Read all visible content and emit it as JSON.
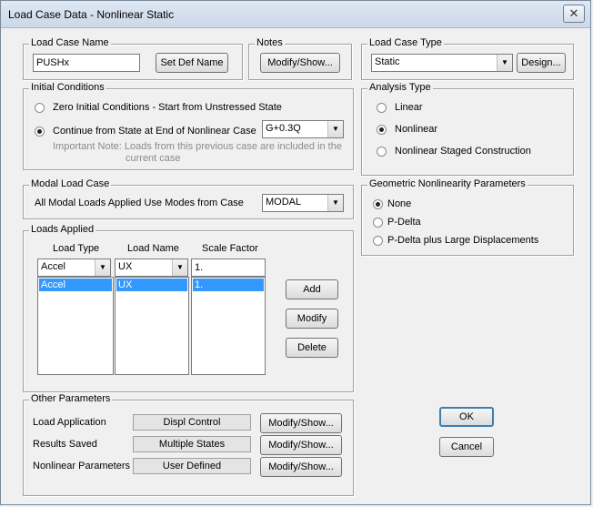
{
  "window": {
    "title": "Load Case Data - Nonlinear Static",
    "close_glyph": "✕"
  },
  "load_case_name": {
    "legend": "Load Case Name",
    "value": "PUSHx",
    "set_def_button": "Set Def Name"
  },
  "notes": {
    "legend": "Notes",
    "button": "Modify/Show..."
  },
  "load_case_type": {
    "legend": "Load Case Type",
    "value": "Static",
    "design_button": "Design..."
  },
  "initial_conditions": {
    "legend": "Initial Conditions",
    "option_zero": "Zero Initial Conditions - Start from Unstressed State",
    "option_continue": "Continue from State at End of Nonlinear Case",
    "continue_case": "G+0.3Q",
    "note_line1": "Important Note:  Loads from this previous case are included in the",
    "note_line2": "current case",
    "selected": "continue"
  },
  "analysis_type": {
    "legend": "Analysis Type",
    "options": [
      "Linear",
      "Nonlinear",
      "Nonlinear Staged Construction"
    ],
    "selected": "Nonlinear"
  },
  "modal_load_case": {
    "legend": "Modal Load Case",
    "label": "All Modal Loads Applied Use Modes from Case",
    "value": "MODAL"
  },
  "geometric_nonlinearity": {
    "legend": "Geometric Nonlinearity Parameters",
    "options": [
      "None",
      "P-Delta",
      "P-Delta plus Large Displacements"
    ],
    "selected": "None"
  },
  "loads_applied": {
    "legend": "Loads Applied",
    "headers": {
      "load_type": "Load Type",
      "load_name": "Load Name",
      "scale_factor": "Scale Factor"
    },
    "edit_row": {
      "load_type": "Accel",
      "load_name": "UX",
      "scale_factor": "1."
    },
    "rows": [
      {
        "load_type": "Accel",
        "load_name": "UX",
        "scale_factor": "1."
      }
    ],
    "buttons": {
      "add": "Add",
      "modify": "Modify",
      "delete": "Delete"
    }
  },
  "other_parameters": {
    "legend": "Other Parameters",
    "rows": [
      {
        "label": "Load Application",
        "value": "Displ Control",
        "button": "Modify/Show..."
      },
      {
        "label": "Results Saved",
        "value": "Multiple States",
        "button": "Modify/Show..."
      },
      {
        "label": "Nonlinear Parameters",
        "value": "User Defined",
        "button": "Modify/Show..."
      }
    ]
  },
  "dialog_buttons": {
    "ok": "OK",
    "cancel": "Cancel"
  },
  "icons": {
    "combo_arrow": "▼"
  }
}
